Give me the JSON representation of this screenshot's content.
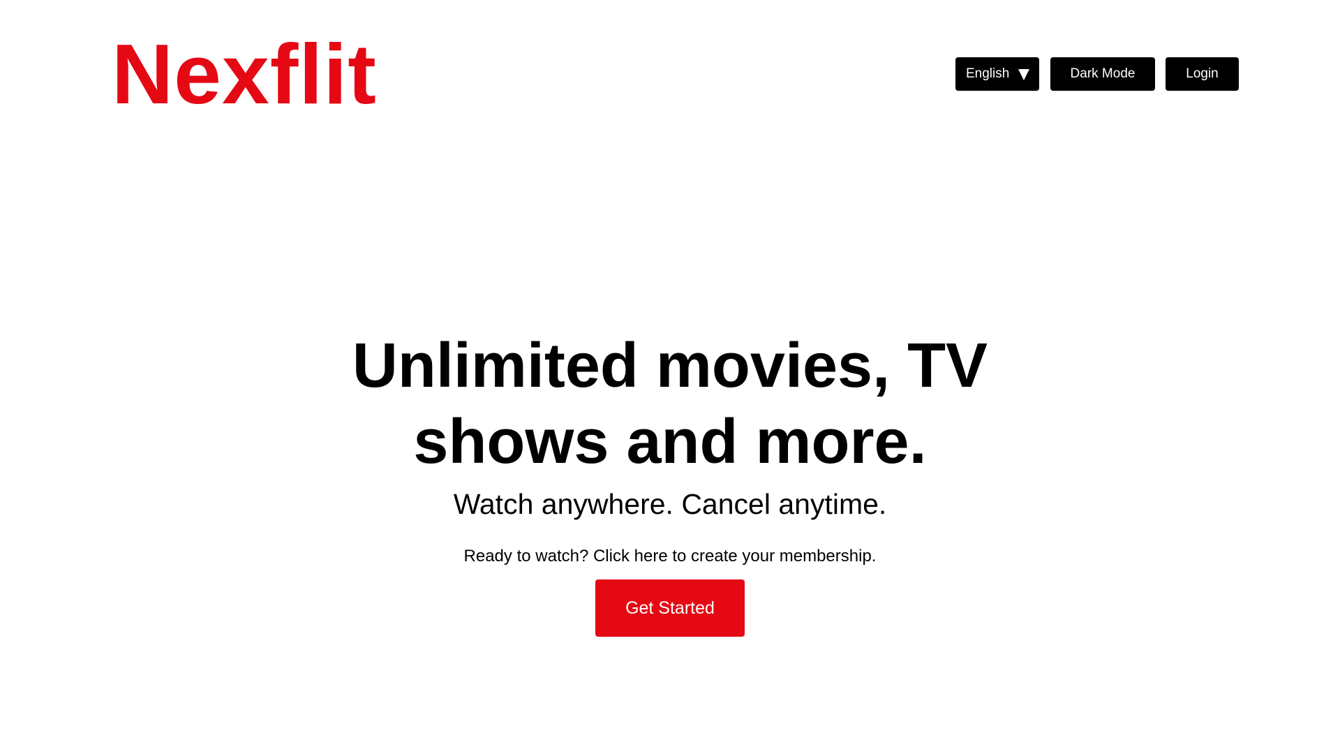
{
  "brand": {
    "name": "Nexflit",
    "accent_color": "#e50914"
  },
  "header": {
    "language": {
      "selected": "English",
      "icon": "caret-down-icon"
    },
    "dark_mode_label": "Dark Mode",
    "login_label": "Login"
  },
  "hero": {
    "title": "Unlimited movies, TV shows and more.",
    "subtitle": "Watch anywhere. Cancel anytime.",
    "cta_text": "Ready to watch? Click here to create your membership.",
    "cta_button": "Get Started"
  }
}
